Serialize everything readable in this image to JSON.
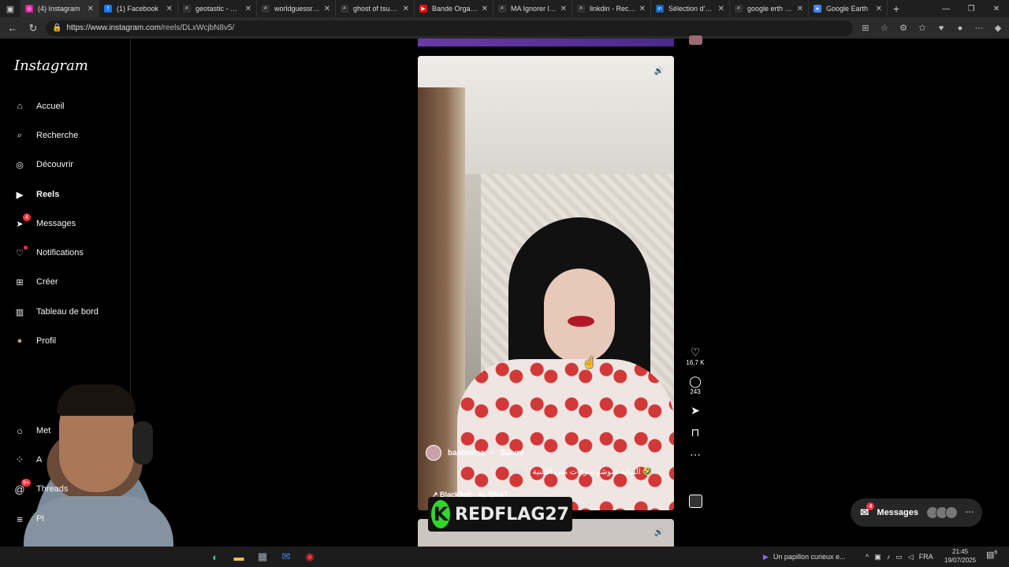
{
  "browser": {
    "tabs": [
      {
        "label": "(4) Instagram",
        "favicon_color": "#d6249f",
        "active": true,
        "fav_glyph": "◎"
      },
      {
        "label": "(1) Facebook",
        "favicon_color": "#1877f2",
        "active": false,
        "fav_glyph": "f"
      },
      {
        "label": "geotastic - Recherche",
        "favicon_color": "#333333",
        "active": false,
        "fav_glyph": "⌕"
      },
      {
        "label": "worldguessr - Recherche",
        "favicon_color": "#333333",
        "active": false,
        "fav_glyph": "⌕"
      },
      {
        "label": "ghost of tsushima",
        "favicon_color": "#333333",
        "active": false,
        "fav_glyph": "⌕"
      },
      {
        "label": "Bande Organisée",
        "favicon_color": "#ff0000",
        "active": false,
        "fav_glyph": "▶"
      },
      {
        "label": "MA Ignorer les liens",
        "favicon_color": "#333333",
        "active": false,
        "fav_glyph": "⌕"
      },
      {
        "label": "linkdin - Recherche",
        "favicon_color": "#333333",
        "active": false,
        "fav_glyph": "⌕"
      },
      {
        "label": "Sélection d'offres",
        "favicon_color": "#0a66c2",
        "active": false,
        "fav_glyph": "in"
      },
      {
        "label": "google erth - Recherche",
        "favicon_color": "#333333",
        "active": false,
        "fav_glyph": "⌕"
      },
      {
        "label": "Google Earth",
        "favicon_color": "#4285f4",
        "active": false,
        "fav_glyph": "●"
      }
    ],
    "url_host": "https://www.instagram.com",
    "url_path": "/reels/DLxWcjbN8v5/"
  },
  "sidebar": {
    "logo": "Instagram",
    "items": [
      {
        "label": "Accueil",
        "icon": "home-icon",
        "glyph": "⌂"
      },
      {
        "label": "Recherche",
        "icon": "search-icon",
        "glyph": "⌕"
      },
      {
        "label": "Découvrir",
        "icon": "compass-icon",
        "glyph": "◎"
      },
      {
        "label": "Reels",
        "icon": "reels-icon",
        "glyph": "▶"
      },
      {
        "label": "Messages",
        "icon": "messages-icon",
        "glyph": "➤",
        "badge": "4"
      },
      {
        "label": "Notifications",
        "icon": "heart-icon",
        "glyph": "♡"
      },
      {
        "label": "Créer",
        "icon": "create-icon",
        "glyph": "⊞"
      },
      {
        "label": "Tableau de bord",
        "icon": "dashboard-icon",
        "glyph": "▥"
      },
      {
        "label": "Profil",
        "icon": "avatar-icon",
        "glyph": "●"
      }
    ],
    "lower": [
      {
        "label": "Met",
        "icon": "meta-ai-icon",
        "glyph": "○"
      },
      {
        "label": "A",
        "icon": "ai-studio-icon",
        "glyph": "⁘"
      },
      {
        "label": "Threads",
        "icon": "threads-icon",
        "glyph": "@",
        "badge": "9+"
      },
      {
        "label": "Pl",
        "icon": "menu-icon",
        "glyph": "≡"
      }
    ]
  },
  "reel": {
    "author": "baatmena",
    "follow": "Suivre",
    "caption_more": "plus",
    "caption": "الشابة شوشو سرقات مني الأغنية 🤣 ...",
    "music": "↗ Black9ett · AL BNAT",
    "likes": "16,7 K",
    "comments": "243"
  },
  "overlay": {
    "brand": "REDFLAG27",
    "brand_mark": "K"
  },
  "messages_pill": {
    "label": "Messages",
    "badge": "4",
    "dots": "···"
  },
  "taskbar": {
    "news": "Un papillon curieux e...",
    "lang": "FRA",
    "time": "21:45",
    "date": "19/07/2025",
    "notif_count": "6"
  }
}
